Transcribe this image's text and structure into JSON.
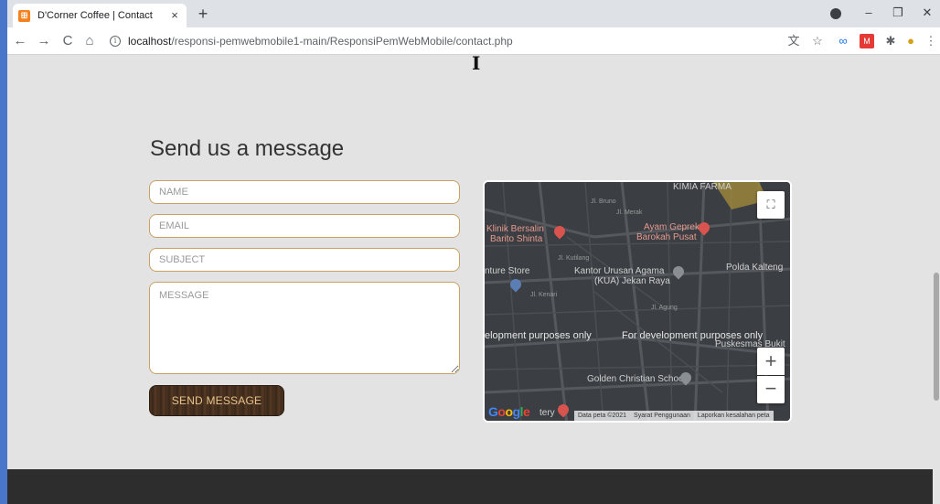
{
  "browser": {
    "tab_title": "D'Corner Coffee | Contact",
    "tab_close": "×",
    "new_tab": "+",
    "url_host": "localhost",
    "url_path": "/responsi-pemwebmobile1-main/ResponsiPemWebMobile/contact.php",
    "window_controls": {
      "minimize": "–",
      "maximize": "❐",
      "close": "✕"
    },
    "nav": {
      "back": "←",
      "forward": "→",
      "reload": "C",
      "home": "⌂"
    }
  },
  "contact": {
    "title": "Send us a message",
    "name_placeholder": "NAME",
    "email_placeholder": "EMAIL",
    "subject_placeholder": "SUBJECT",
    "message_placeholder": "MESSAGE",
    "send_label": "SEND MESSAGE",
    "button_color": "#4b3322",
    "field_border_color": "#c8a064"
  },
  "map": {
    "labels": {
      "kimia_farma": "KIMIA FARMA",
      "klinik": "Klinik Bersalin",
      "klinik2": "Barito Shinta",
      "ayam": "Ayam Geprek",
      "ayam2": "Barokah Pusat",
      "polda": "Polda Kalteng",
      "furniture": "nture Store",
      "kua": "Kantor Urusan Agama",
      "kua2": "(KUA) Jekan Raya",
      "dev_left": "elopment purposes only",
      "dev_right": "For development purposes only",
      "puskesmas": "Puskesmas Bukit",
      "golden": "Golden Christian School",
      "tery": "tery",
      "street_bruno": "Jl. Bruno",
      "street_merak": "Jl. Merak",
      "street_kutilang": "Jl. Kutilang",
      "street_kenari": "Jl. Kenari",
      "street_agung": "Jl. Agung"
    },
    "zoom_in": "+",
    "zoom_out": "−",
    "fullscreen": "⛶",
    "logo": [
      "G",
      "o",
      "o",
      "g",
      "l",
      "e"
    ],
    "attribution": {
      "data": "Data peta ©2021",
      "terms": "Syarat Penggunaan",
      "report": "Laporkan kesalahan peta"
    }
  }
}
